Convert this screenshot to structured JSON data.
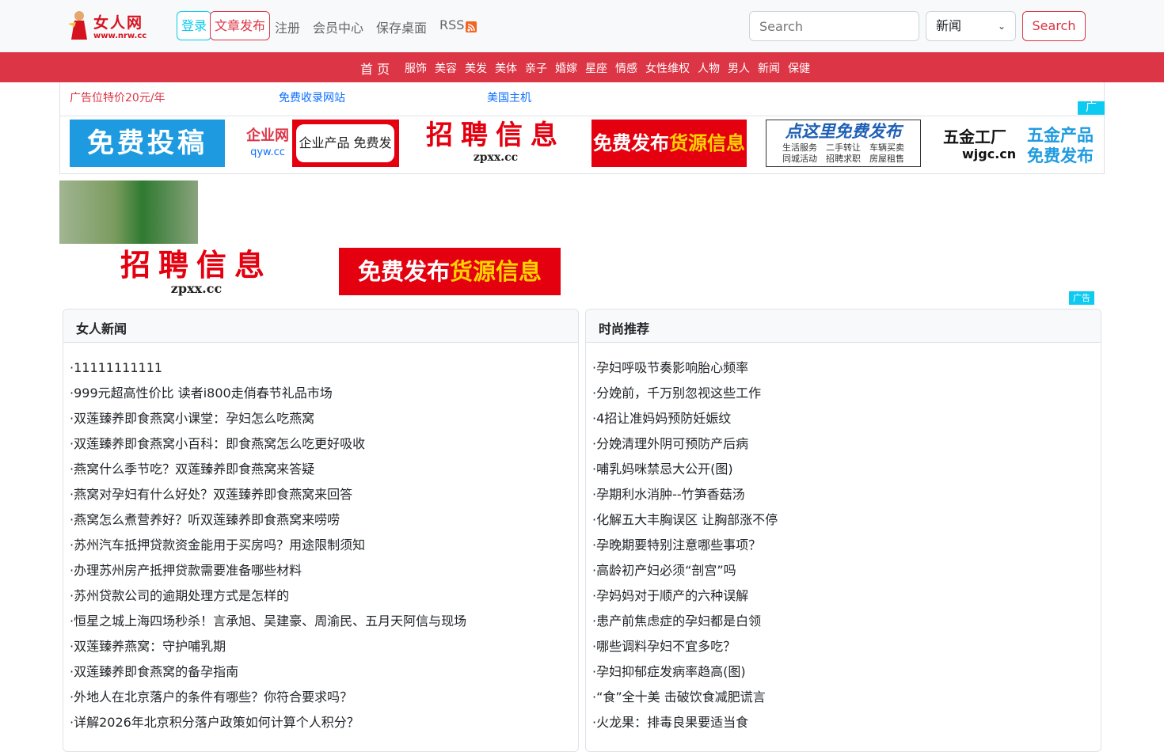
{
  "header": {
    "logo_text": "女人网",
    "logo_url": "www.nrw.cc",
    "login": "登录",
    "post_article": "文章发布",
    "nav": [
      "注册",
      "会员中心",
      "保存桌面",
      "RSS"
    ],
    "search_placeholder": "Search",
    "search_select": "新闻",
    "search_button": "Search"
  },
  "menu": {
    "home": "首 页",
    "items": [
      "服饰",
      "美容",
      "美发",
      "美体",
      "亲子",
      "婚嫁",
      "星座",
      "情感",
      "女性维权",
      "人物",
      "男人",
      "新闻",
      "保健"
    ]
  },
  "ad_links": [
    "广告位特价20元/年",
    "免费收录网站",
    "美国主机"
  ],
  "ad_tag": "广",
  "ad_tag2": "广告",
  "banners": {
    "b1": "免费投稿",
    "b2_logo": "企业网",
    "b2_url": "qyw.cc",
    "b2_text": "企业产品 免费发布",
    "b3_title": "招聘信息",
    "b3_url": "zpxx.cc",
    "b4_a": "免费发布",
    "b4_b": "货源信息",
    "b5_title": "点这里免费发布",
    "b5_line1": "生活服务　二手转让　车辆买卖",
    "b5_line2": "同城活动　招聘求职　房屋租售",
    "b6_logo": "五金工厂",
    "b6_url": "wjgc.cn",
    "b6_text1": "五金产品",
    "b6_text2": "免费发布"
  },
  "colors": {
    "brand_red": "#dc3545",
    "info": "#0dcaf0",
    "link": "#0d6efd"
  },
  "left_card": {
    "title": "女人新闻",
    "items": [
      "·11111111111",
      "·999元超高性价比 读者i800走俏春节礼品市场",
      "·双莲臻养即食燕窝小课堂：孕妇怎么吃燕窝",
      "·双莲臻养即食燕窝小百科：即食燕窝怎么吃更好吸收",
      "·燕窝什么季节吃？双莲臻养即食燕窝来答疑",
      "·燕窝对孕妇有什么好处？双莲臻养即食燕窝来回答",
      "·燕窝怎么煮营养好？听双莲臻养即食燕窝来唠唠",
      "·苏州汽车抵押贷款资金能用于买房吗？用途限制须知",
      "·办理苏州房产抵押贷款需要准备哪些材料",
      "·苏州贷款公司的逾期处理方式是怎样的",
      "·恒星之城上海四场秒杀！言承旭、吴建豪、周渝民、五月天阿信与现场",
      "·双莲臻养燕窝：守护哺乳期",
      "·双莲臻养即食燕窝的备孕指南",
      "·外地人在北京落户的条件有哪些？你符合要求吗？",
      "·详解2026年北京积分落户政策如何计算个人积分？"
    ]
  },
  "right_card": {
    "title": "时尚推荐",
    "items": [
      "·孕妇呼吸节奏影响胎心频率",
      "·分娩前，千万别忽视这些工作",
      "·4招让准妈妈预防妊娠纹",
      "·分娩清理外阴可预防产后病",
      "·哺乳妈咪禁忌大公开(图)",
      "·孕期利水消肿--竹笋香菇汤",
      "·化解五大丰胸误区 让胸部涨不停",
      "·孕晚期要特别注意哪些事项？",
      "·高龄初产妇必须“剖宫”吗",
      "·孕妈妈对于顺产的六种误解",
      "·患产前焦虑症的孕妇都是白领",
      "·哪些调料孕妇不宜多吃？",
      "·孕妇抑郁症发病率趋高(图)",
      "·“食”全十美 击破饮食减肥谎言",
      "·火龙果：排毒良果要适当食"
    ]
  }
}
